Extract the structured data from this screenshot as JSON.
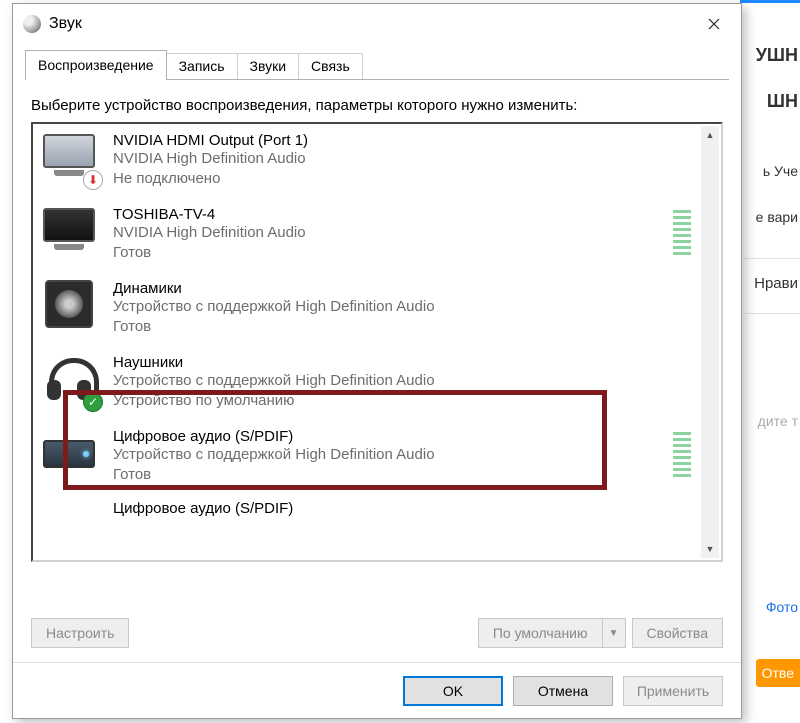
{
  "dialog": {
    "title": "Звук",
    "tabs": [
      {
        "label": "Воспроизведение",
        "active": true
      },
      {
        "label": "Запись",
        "active": false
      },
      {
        "label": "Звуки",
        "active": false
      },
      {
        "label": "Связь",
        "active": false
      }
    ],
    "instruction": "Выберите устройство воспроизведения, параметры которого нужно изменить:",
    "devices": [
      {
        "name": "NVIDIA HDMI Output (Port 1)",
        "driver": "NVIDIA High Definition Audio",
        "status": "Не подключено",
        "icon": "monitor",
        "badge": "disconnected",
        "meter": false
      },
      {
        "name": "TOSHIBA-TV-4",
        "driver": "NVIDIA High Definition Audio",
        "status": "Готов",
        "icon": "monitor-dark",
        "badge": null,
        "meter": true
      },
      {
        "name": "Динамики",
        "driver": "Устройство с поддержкой High Definition Audio",
        "status": "Готов",
        "icon": "speaker",
        "badge": null,
        "meter": false
      },
      {
        "name": "Наушники",
        "driver": "Устройство с поддержкой High Definition Audio",
        "status": "Устройство по умолчанию",
        "icon": "headphones",
        "badge": "default",
        "meter": false,
        "highlighted": true
      },
      {
        "name": "Цифровое аудио (S/PDIF)",
        "driver": "Устройство с поддержкой High Definition Audio",
        "status": "Готов",
        "icon": "spdif",
        "badge": null,
        "meter": true
      },
      {
        "name": "Цифровое аудио (S/PDIF)",
        "driver": "",
        "status": "",
        "icon": "",
        "badge": null,
        "meter": false,
        "partial": true
      }
    ],
    "buttons": {
      "configure": "Настроить",
      "set_default": "По умолчанию",
      "properties": "Свойства",
      "ok": "OK",
      "cancel": "Отмена",
      "apply": "Применить"
    }
  },
  "background": {
    "frag1": "УШН",
    "frag2": "ШН",
    "frag3": "ь Уче",
    "frag4": "е вари",
    "frag5": "Нрави",
    "frag6": "дите т",
    "link_photo": "Фото",
    "btn_answer": "Отве"
  }
}
